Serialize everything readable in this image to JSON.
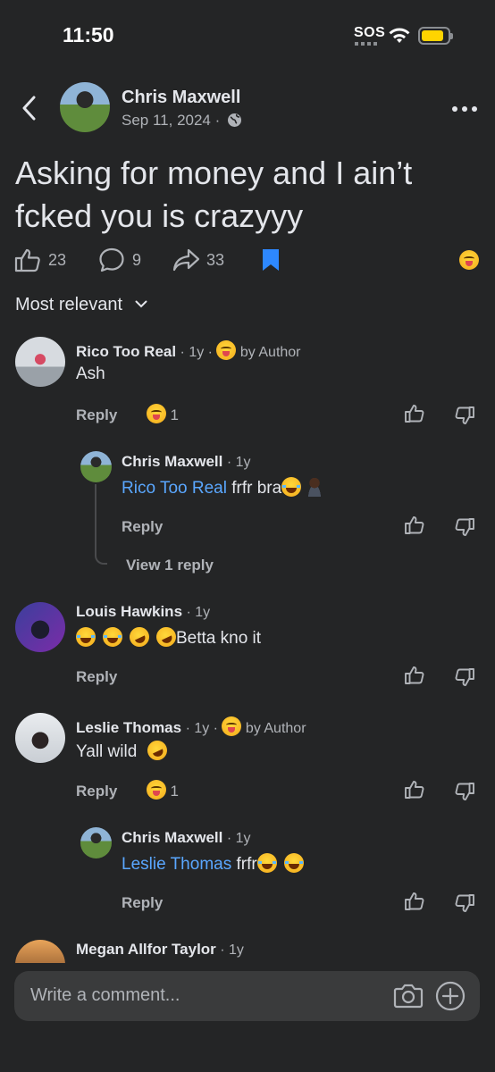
{
  "status": {
    "time": "11:50",
    "sos": "SOS"
  },
  "post": {
    "author": "Chris Maxwell",
    "date": "Sep 11, 2024",
    "date_separator": "·",
    "text_line1": "Asking for money and I ain’t",
    "text_line2": "fcked you is crazyyy",
    "likes": "23",
    "comments": "9",
    "shares": "33"
  },
  "sort": {
    "label": "Most relevant"
  },
  "comments": [
    {
      "name": "Rico Too Real",
      "time": "· 1y ·",
      "badge": "by Author",
      "text": "Ash",
      "reply_label": "Reply",
      "reaction_count": "1",
      "replies": [
        {
          "name": "Chris Maxwell",
          "time": "· 1y",
          "mention": "Rico Too Real",
          "text": "frfr bra",
          "reply_label": "Reply",
          "view_replies": "View 1 reply"
        }
      ]
    },
    {
      "name": "Louis Hawkins",
      "time": "· 1y",
      "text": "Betta kno it",
      "reply_label": "Reply"
    },
    {
      "name": "Leslie Thomas",
      "time": "· 1y ·",
      "badge": "by Author",
      "text": "Yall wild",
      "reply_label": "Reply",
      "reaction_count": "1",
      "replies": [
        {
          "name": "Chris Maxwell",
          "time": "· 1y",
          "mention": "Leslie Thomas",
          "text": "frfr",
          "reply_label": "Reply"
        }
      ]
    },
    {
      "name": "Megan Allfor Taylor",
      "time": "· 1y"
    }
  ],
  "composer": {
    "placeholder": "Write a comment..."
  },
  "icons": {
    "back": "chevron-left-icon",
    "more": "more-horizontal-icon",
    "globe": "globe-icon",
    "like": "thumbs-up-icon",
    "comment": "comment-bubble-icon",
    "share": "share-arrow-icon",
    "save": "bookmark-icon",
    "dislike": "thumbs-down-icon",
    "camera": "camera-icon",
    "add": "plus-circle-icon"
  },
  "colors": {
    "background": "#242526",
    "accent": "#5aa7ff",
    "bookmark": "#2d88ff",
    "battery": "#ffd400"
  }
}
